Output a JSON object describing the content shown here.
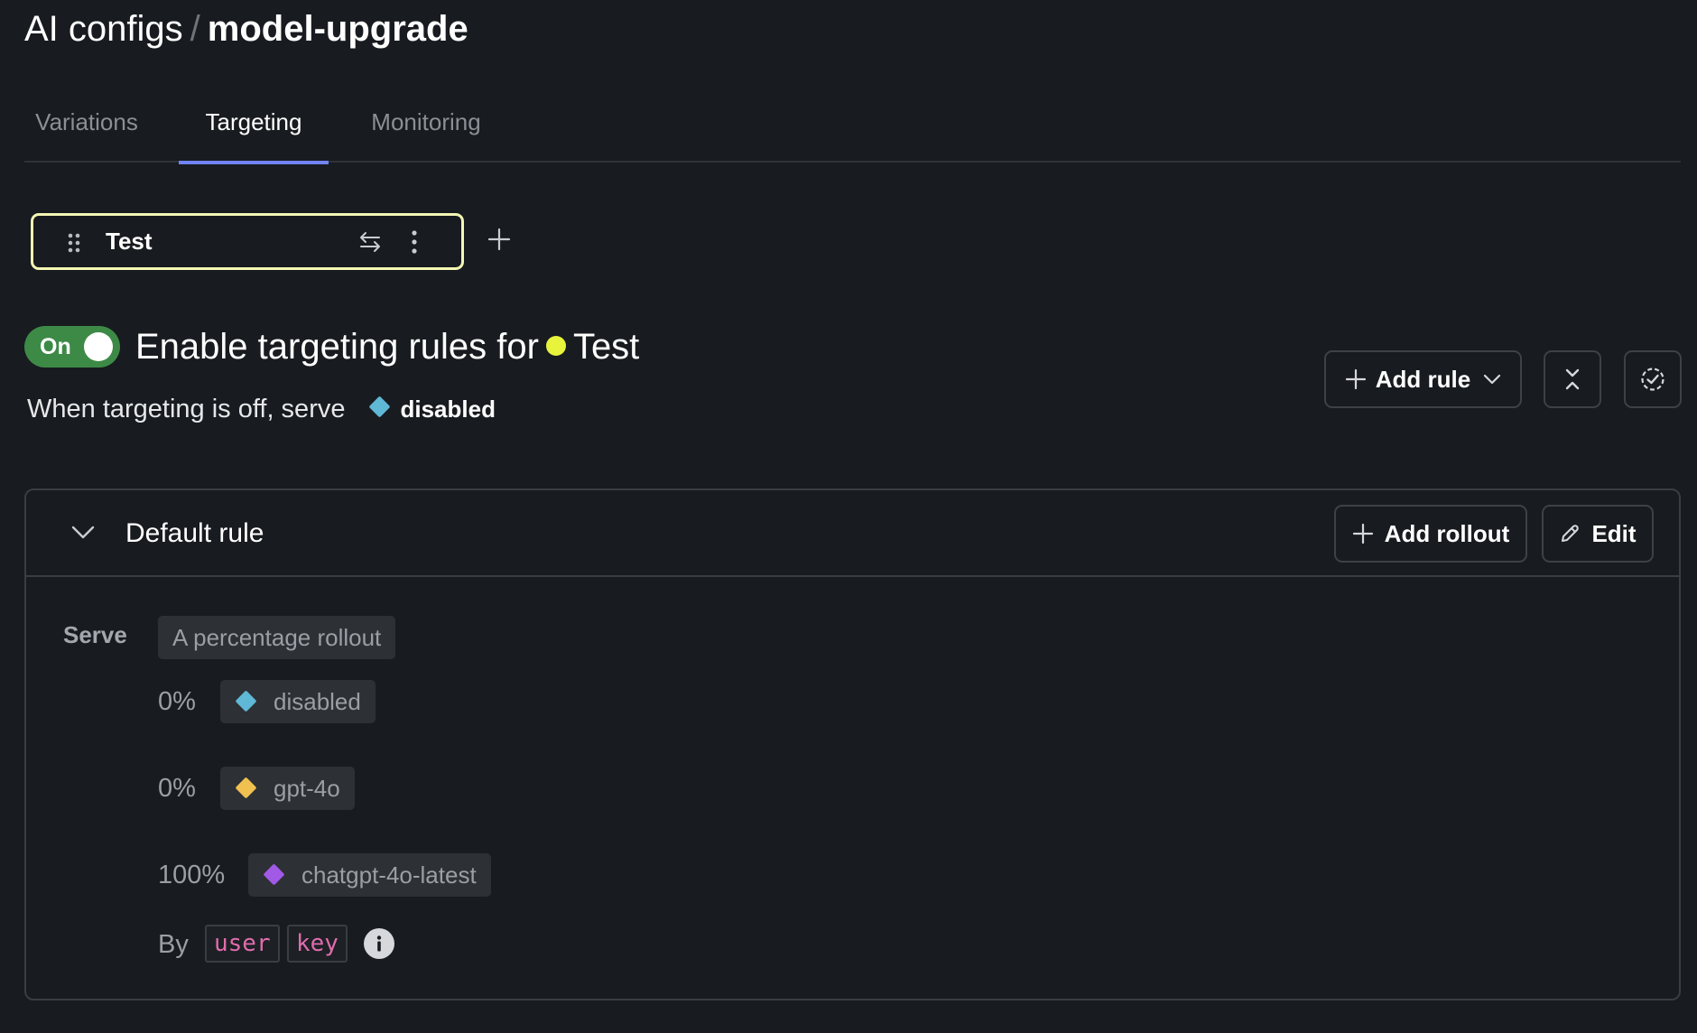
{
  "breadcrumb": {
    "parent": "AI configs",
    "separator": "/",
    "current": "model-upgrade"
  },
  "tabs": [
    {
      "label": "Variations",
      "active": false
    },
    {
      "label": "Targeting",
      "active": true
    },
    {
      "label": "Monitoring",
      "active": false
    }
  ],
  "environment_chip": {
    "label": "Test",
    "grip_icon": "drag-handle-icon",
    "swap_icon": "swap-arrows-icon",
    "menu_icon": "kebab-menu-icon",
    "border_color": "#f4f7b3"
  },
  "add_environment_icon": "plus-icon",
  "targeting": {
    "toggle_label": "On",
    "toggle_on": true,
    "toggle_color": "#3d8a47",
    "heading_prefix": "Enable targeting rules for",
    "environment_name": "Test",
    "environment_color": "#e8f33c",
    "off_serve_text": "When targeting is off, serve",
    "off_variation": {
      "name": "disabled",
      "color": "#5fb8d6"
    }
  },
  "actions": {
    "add_rule_label": "Add rule",
    "collapse_icon": "collapse-all-icon",
    "review_icon": "dashed-check-circle-icon"
  },
  "default_rule": {
    "title": "Default rule",
    "add_rollout_label": "Add rollout",
    "edit_label": "Edit",
    "serve_label": "Serve",
    "serve_type": "A percentage rollout",
    "rollout": [
      {
        "percent": "0%",
        "variation": "disabled",
        "color": "#5fb8d6"
      },
      {
        "percent": "0%",
        "variation": "gpt-4o",
        "color": "#f0c050"
      },
      {
        "percent": "100%",
        "variation": "chatgpt-4o-latest",
        "color": "#a259e6"
      }
    ],
    "by_label": "By",
    "bucket_by": [
      "user",
      "key"
    ]
  },
  "colors": {
    "background": "#181b1f",
    "accent_tab": "#7084f5",
    "border": "#3a3d42",
    "code_text": "#e06cad"
  }
}
